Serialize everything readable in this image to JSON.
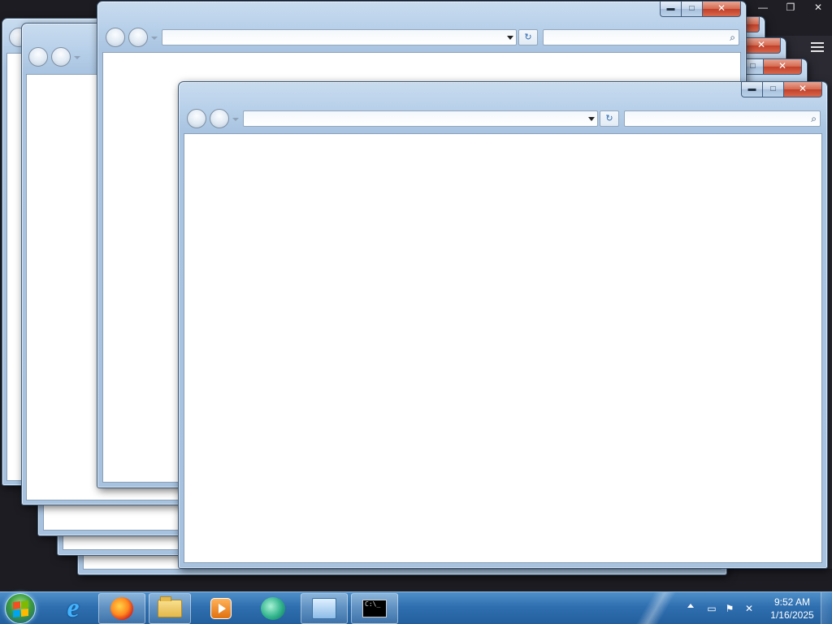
{
  "desktop": {
    "dark_browser": {
      "minimize_glyph": "—",
      "restore_glyph": "❐",
      "close_glyph": "✕"
    },
    "explorer_windows": {
      "count": 8,
      "minimize_glyph": "▬",
      "maximize_glyph": "□",
      "close_glyph": "✕",
      "address_value": "",
      "search_value": "",
      "refresh_glyph": "↻",
      "search_glyph": "⌕"
    }
  },
  "taskbar": {
    "pinned": [
      {
        "name": "Internet Explorer",
        "icon": "ie-icon",
        "glyph": "e"
      },
      {
        "name": "Firefox",
        "icon": "firefox-icon"
      },
      {
        "name": "Windows Explorer",
        "icon": "folder-icon"
      },
      {
        "name": "Windows Media Player",
        "icon": "media-player-icon"
      },
      {
        "name": "App",
        "icon": "green-app-icon"
      },
      {
        "name": "Remote Desktop",
        "icon": "remote-desktop-icon"
      },
      {
        "name": "Command Prompt",
        "icon": "cmd-icon",
        "glyph": "C:\\_"
      }
    ],
    "tray": {
      "show_hidden_icon": "chevron-up-icon",
      "network_icon": "network-icon",
      "flag_icon": "action-center-flag-icon",
      "volume_icon": "volume-muted-icon",
      "time": "9:52 AM",
      "date": "1/16/2025"
    }
  }
}
